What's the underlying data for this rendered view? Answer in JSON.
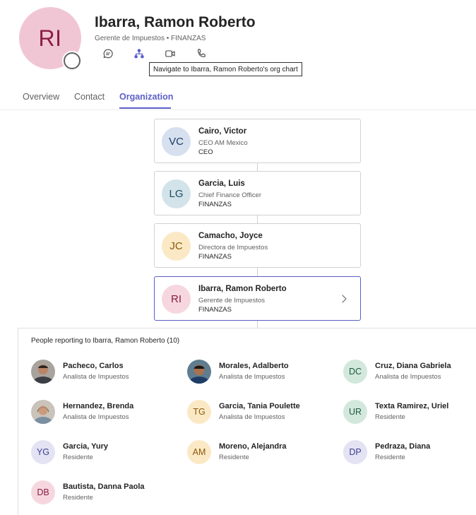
{
  "profile": {
    "initials": "RI",
    "name": "Ibarra, Ramon Roberto",
    "subtitle": "Gerente de Impuestos • FINANZAS",
    "avatar_bg": "#f1c6d4",
    "avatar_fg": "#8a1c43"
  },
  "actions": [
    {
      "icon": "chat-icon"
    },
    {
      "icon": "org-chart-icon"
    },
    {
      "icon": "video-call-icon"
    },
    {
      "icon": "phone-call-icon"
    }
  ],
  "tooltip": "Navigate to Ibarra, Ramon Roberto's org chart",
  "tabs": [
    {
      "label": "Overview"
    },
    {
      "label": "Contact"
    },
    {
      "label": "Organization",
      "active": true
    }
  ],
  "accent_color": "#5b5fc7",
  "chain": [
    {
      "initials": "VC",
      "name": "Cairo, Victor",
      "title": "CEO AM Mexico",
      "department": "CEO",
      "bg": "#d6e0ee",
      "fg": "#1f3a68"
    },
    {
      "initials": "LG",
      "name": "Garcia, Luis",
      "title": "Chief Finance Officer",
      "department": "FINANZAS",
      "bg": "#d3e3ea",
      "fg": "#1e4c5e"
    },
    {
      "initials": "JC",
      "name": "Camacho, Joyce",
      "title": "Directora de Impuestos",
      "department": "FINANZAS",
      "bg": "#fbe9c6",
      "fg": "#8a5a08"
    },
    {
      "initials": "RI",
      "name": "Ibarra, Ramon Roberto",
      "title": "Gerente de Impuestos",
      "department": "FINANZAS",
      "bg": "#f6d7e0",
      "fg": "#8a1c43"
    }
  ],
  "reports": {
    "header": "People reporting to Ibarra, Ramon Roberto (10)",
    "people": [
      {
        "name": "Pacheco, Carlos",
        "title": "Analista de Impuestos",
        "photo": true
      },
      {
        "name": "Morales, Adalberto",
        "title": "Analista de Impuestos",
        "photo": true
      },
      {
        "name": "Cruz, Diana Gabriela",
        "title": "Analista de Impuestos",
        "initials": "DC",
        "bg": "#d2e8dd",
        "fg": "#1f5a3d"
      },
      {
        "name": "Hernandez, Brenda",
        "title": "Analista de Impuestos",
        "photo": true
      },
      {
        "name": "Garcia, Tania Poulette",
        "title": "Analista de Impuestos",
        "initials": "TG",
        "bg": "#fbe9c6",
        "fg": "#8a5a08"
      },
      {
        "name": "Texta Ramirez, Uriel",
        "title": "Residente",
        "initials": "UR",
        "bg": "#d2e8dd",
        "fg": "#1f5a3d"
      },
      {
        "name": "Garcia, Yury",
        "title": "Residente",
        "initials": "YG",
        "bg": "#e3e3f4",
        "fg": "#3b3e8f"
      },
      {
        "name": "Moreno, Alejandra",
        "title": "Residente",
        "initials": "AM",
        "bg": "#fbe9c6",
        "fg": "#8a5a08"
      },
      {
        "name": "Pedraza, Diana",
        "title": "Residente",
        "initials": "DP",
        "bg": "#e3e3f4",
        "fg": "#3b3e8f"
      },
      {
        "name": "Bautista, Danna Paola",
        "title": "Residente",
        "initials": "DB",
        "bg": "#f6d7e0",
        "fg": "#8a1c43"
      }
    ]
  }
}
